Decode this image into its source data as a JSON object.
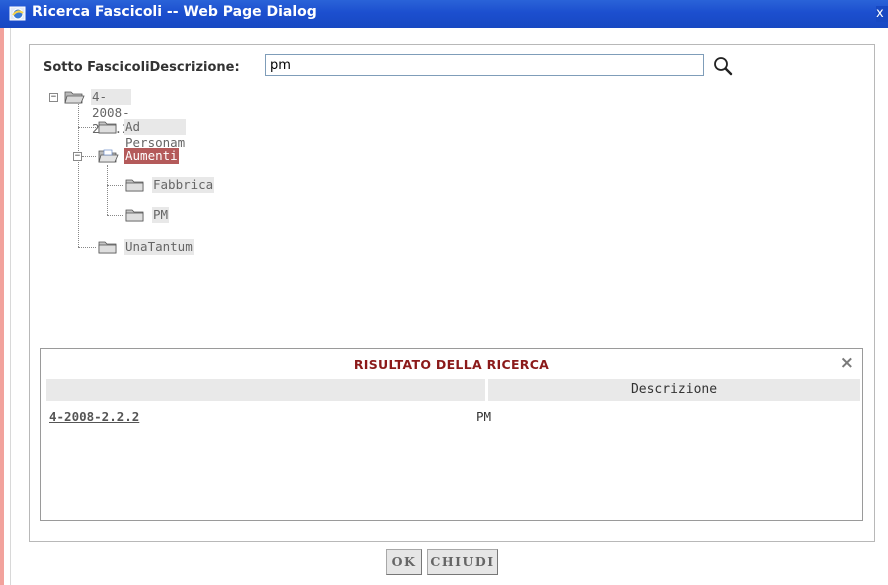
{
  "window": {
    "title": "Ricerca Fascicoli -- Web Page Dialog",
    "close_glyph": "x",
    "icon": "ie-window-icon"
  },
  "search": {
    "label": "Sotto FascicoliDescrizione:",
    "value": "pm",
    "button_icon": "magnifier-icon"
  },
  "tree": {
    "root": {
      "label": "4-2008-2.2.2",
      "expanded": true
    },
    "children": [
      {
        "label": "Ad Personam"
      },
      {
        "label": "Aumenti",
        "expanded": true,
        "selected": true,
        "children": [
          {
            "label": "Fabbrica"
          },
          {
            "label": "PM"
          }
        ]
      },
      {
        "label": "UnaTantum"
      }
    ]
  },
  "results": {
    "title": "RISULTATO DELLA RICERCA",
    "close_glyph": "×",
    "columns": [
      "",
      "Descrizione"
    ],
    "rows": [
      {
        "code": "4-2008-2.2.2",
        "descrizione": "PM"
      }
    ]
  },
  "buttons": {
    "ok": "OK",
    "chiudi": "CHIUDI"
  },
  "colors": {
    "titlebar": "#1c4fcf",
    "results_title": "#8b1a1a",
    "selected_node": "#b45a5a"
  }
}
